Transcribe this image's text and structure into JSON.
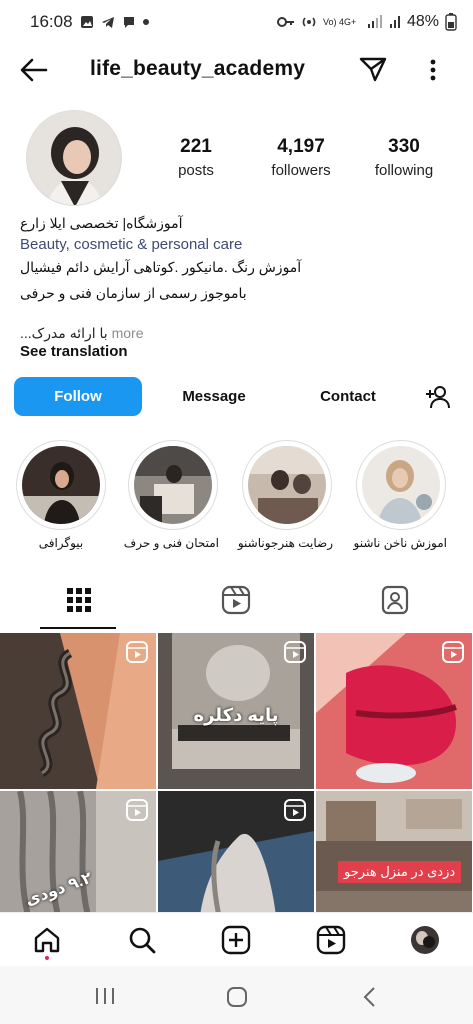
{
  "status_bar": {
    "time": "16:08",
    "network": "Vo) 4G+",
    "battery": "48%"
  },
  "header": {
    "username": "life_beauty_academy"
  },
  "profile": {
    "stats": [
      {
        "num": "221",
        "label": "posts"
      },
      {
        "num": "4,197",
        "label": "followers"
      },
      {
        "num": "330",
        "label": "following"
      }
    ],
    "bio": {
      "name": "آموزشگاه| تخصصی ایلا زارع",
      "category": "Beauty, cosmetic & personal care",
      "line1": "آموزش رنگ .مانیکور .کوتاهی آرایش دائم فیشیال",
      "line2": "باموجوز رسمی از سازمان فنی و حرفی",
      "line3": "...با ارائه مدرک",
      "more": "more"
    },
    "see_translation": "See translation"
  },
  "actions": {
    "follow": "Follow",
    "message": "Message",
    "contact": "Contact"
  },
  "highlights": [
    {
      "label": "بیوگرافی"
    },
    {
      "label": "امتحان فنی و حرف"
    },
    {
      "label": "رضایت هنرجوناشنو"
    },
    {
      "label": "اموزش ناخن ناشنو"
    }
  ],
  "grid": {
    "posts": [
      {
        "caption": ""
      },
      {
        "caption": "پایه دکلره"
      },
      {
        "caption": ""
      },
      {
        "caption": "۹.۲ دودی"
      },
      {
        "caption": ""
      },
      {
        "caption": "دزدی در منزل هنرجو"
      }
    ]
  },
  "colors": {
    "follow_button": "#1a97f0",
    "category_text": "#3f4a74"
  }
}
